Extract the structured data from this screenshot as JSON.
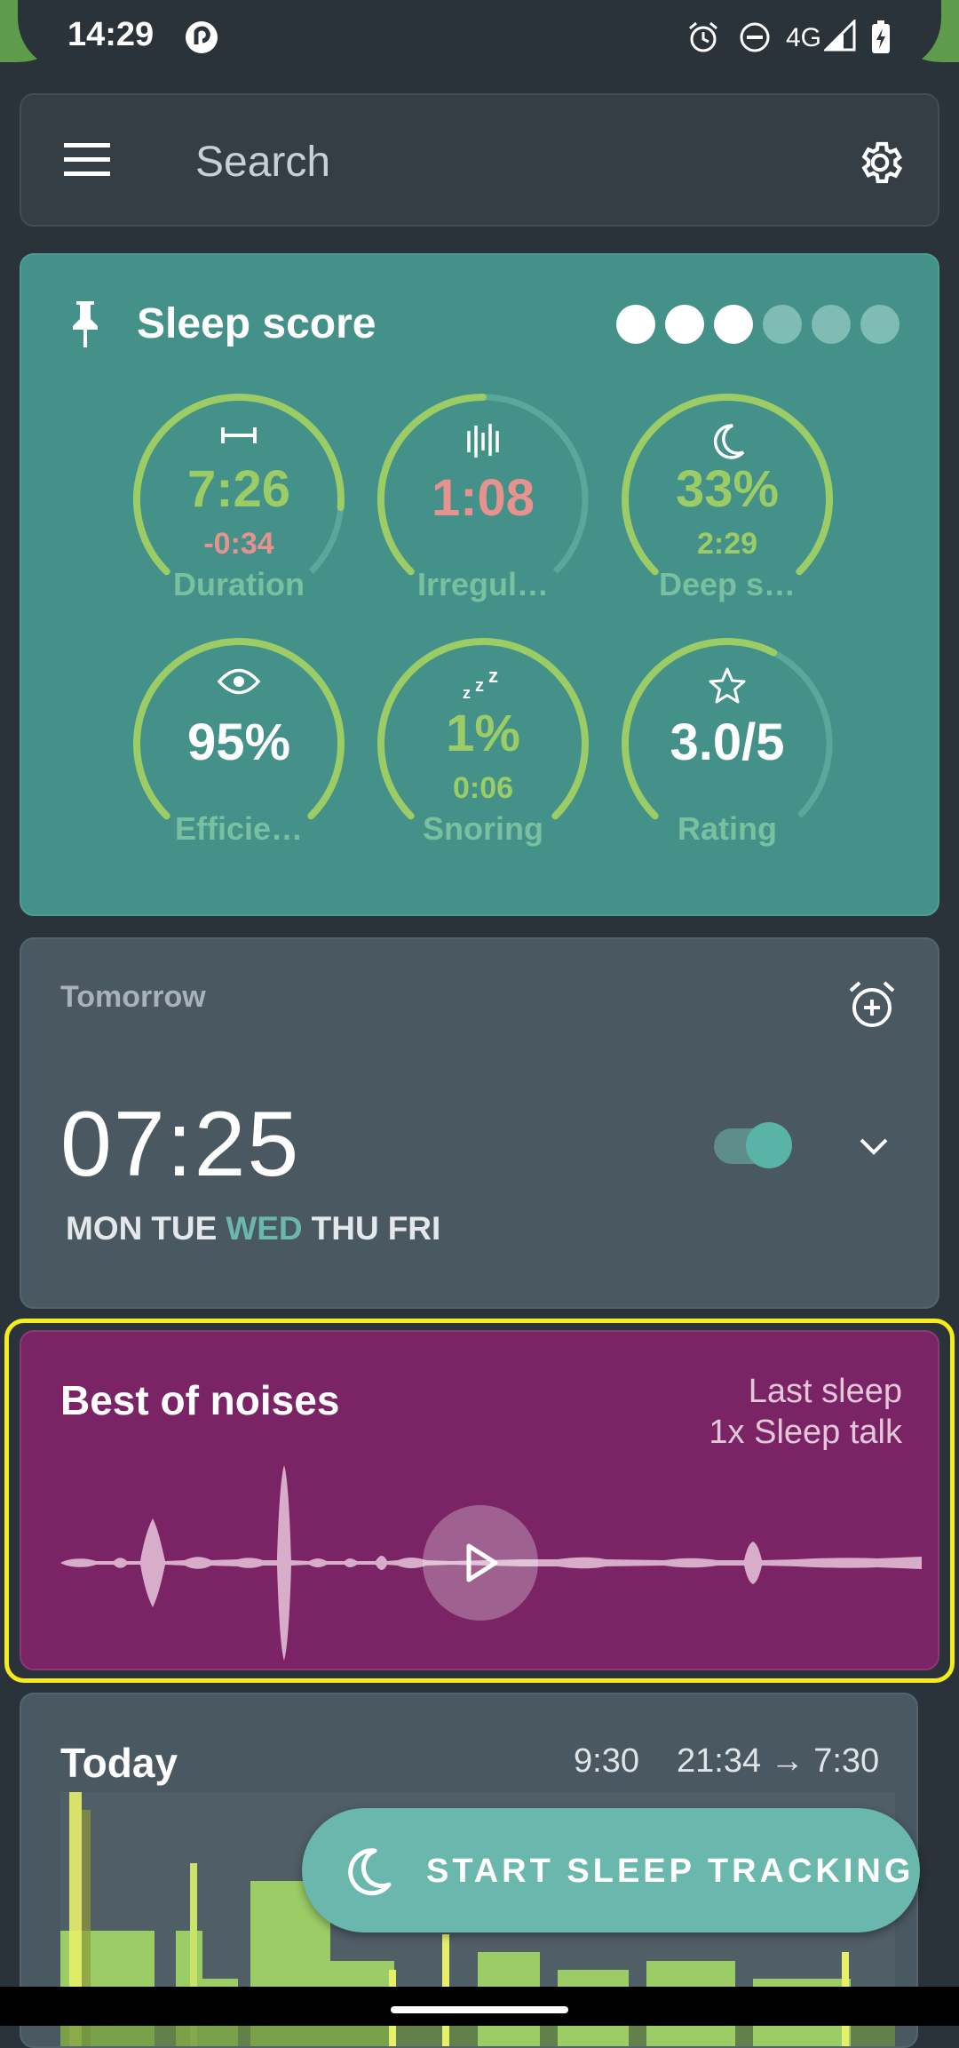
{
  "status_bar": {
    "time": "14:29",
    "network": "4G",
    "icons": [
      "pocket-casts-icon",
      "alarm-icon",
      "do-not-disturb-icon",
      "signal-icon",
      "battery-charging-icon"
    ]
  },
  "search_bar": {
    "placeholder": "Search",
    "icons": [
      "menu-icon",
      "settings-gear-icon"
    ]
  },
  "sleep_score": {
    "title": "Sleep score",
    "score_dots_filled": 3,
    "score_dots_total": 6,
    "gauges": [
      {
        "icon": "duration-icon",
        "value": "7:26",
        "sub": "-0:34",
        "label": "Duration",
        "value_color": "#9ccc65",
        "sub_color": "#e8928f",
        "progress": 0.85
      },
      {
        "icon": "irregularity-icon",
        "value": "1:08",
        "sub": "",
        "label": "Irregul…",
        "value_color": "#e8928f",
        "sub_color": "",
        "progress": 0.5
      },
      {
        "icon": "moon-icon",
        "value": "33%",
        "sub": "2:29",
        "label": "Deep s…",
        "value_color": "#9ccc65",
        "sub_color": "#9ccc65",
        "progress": 1.0
      },
      {
        "icon": "eye-icon",
        "value": "95%",
        "sub": "",
        "label": "Efficie…",
        "value_color": "#ffffff",
        "sub_color": "",
        "progress": 1.0
      },
      {
        "icon": "zzz-icon",
        "value": "1%",
        "sub": "0:06",
        "label": "Snoring",
        "value_color": "#9ccc65",
        "sub_color": "#9ccc65",
        "progress": 1.0
      },
      {
        "icon": "star-icon",
        "value": "3.0/5",
        "sub": "",
        "label": "Rating",
        "value_color": "#ffffff",
        "sub_color": "",
        "progress": 0.6
      }
    ],
    "colors": {
      "arc": "#9ccc65",
      "track": "#5aa89b",
      "dot_on": "#ffffff",
      "dot_off": "#7fbcb3"
    }
  },
  "alarm": {
    "heading": "Tomorrow",
    "time": "07:25",
    "days": [
      {
        "label": "MON",
        "active": false
      },
      {
        "label": "TUE",
        "active": false
      },
      {
        "label": "WED",
        "active": true
      },
      {
        "label": "THU",
        "active": false
      },
      {
        "label": "FRI",
        "active": false
      }
    ],
    "enabled": true,
    "colors": {
      "day": "#e4e8ea",
      "day_active": "#6ab7ad"
    }
  },
  "noises": {
    "title": "Best of noises",
    "subtitle_line1": "Last sleep",
    "subtitle_line2": "1x Sleep talk"
  },
  "today": {
    "title": "Today",
    "duration": "9:30",
    "range": "21:34 → 7:30"
  },
  "fab": {
    "label": "START SLEEP TRACKING"
  }
}
